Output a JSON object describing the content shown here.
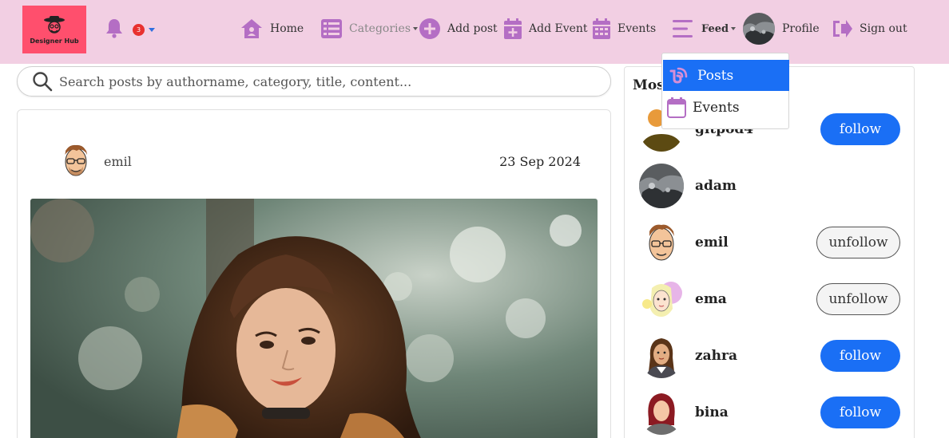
{
  "brand": {
    "logo_text": "Designer Hub",
    "accent": "#ff4f6d"
  },
  "nav": {
    "notification_count": "3",
    "home": "Home",
    "categories": "Categories",
    "add_post": "Add post",
    "add_event": "Add Event",
    "events": "Events",
    "feed": "Feed",
    "profile": "Profile",
    "sign_out": "Sign out"
  },
  "feed_dropdown": {
    "posts": "Posts",
    "events": "Events"
  },
  "search": {
    "placeholder": "Search posts by authorname, category, title, content..."
  },
  "post": {
    "author": "emil",
    "date": "23 Sep 2024"
  },
  "panel": {
    "title": "Most",
    "users": [
      {
        "name": "gitpod4",
        "action": "follow"
      },
      {
        "name": "adam",
        "action": ""
      },
      {
        "name": "emil",
        "action": "unfollow"
      },
      {
        "name": "ema",
        "action": "unfollow"
      },
      {
        "name": "zahra",
        "action": "follow"
      },
      {
        "name": "bina",
        "action": "follow"
      }
    ]
  },
  "colors": {
    "navbar": "#f2cfe3",
    "icon_purple": "#b46ec4",
    "primary": "#1a6ff5"
  }
}
